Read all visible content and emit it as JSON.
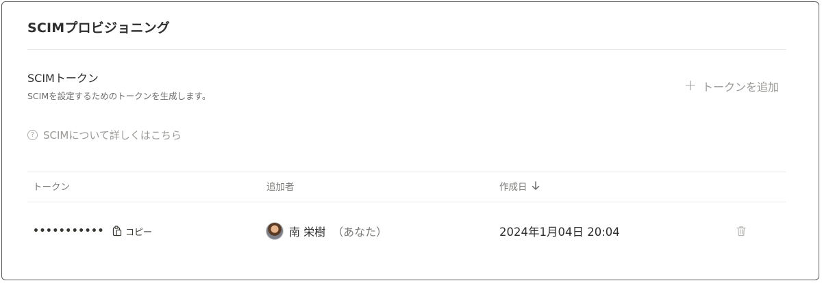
{
  "section": {
    "title": "SCIMプロビジョニング"
  },
  "token_section": {
    "heading": "SCIMトークン",
    "description": "SCIMを設定するためのトークンを生成します。",
    "add_button_label": "トークンを追加",
    "learn_more_label": "SCIMについて詳しくはこちら"
  },
  "table": {
    "columns": {
      "token": "トークン",
      "added_by": "追加者",
      "created_at": "作成日"
    },
    "rows": [
      {
        "token_masked": "•••••••••••",
        "copy_label": "コピー",
        "added_by_name": "南 栄樹",
        "added_by_tag": "（あなた）",
        "created_at": "2024年1月04日 20:04"
      }
    ]
  },
  "icons": {
    "add": "plus-icon",
    "help": "question-circle-icon",
    "sort": "arrow-down-icon",
    "copy": "clipboard-icon",
    "delete": "trash-icon"
  }
}
